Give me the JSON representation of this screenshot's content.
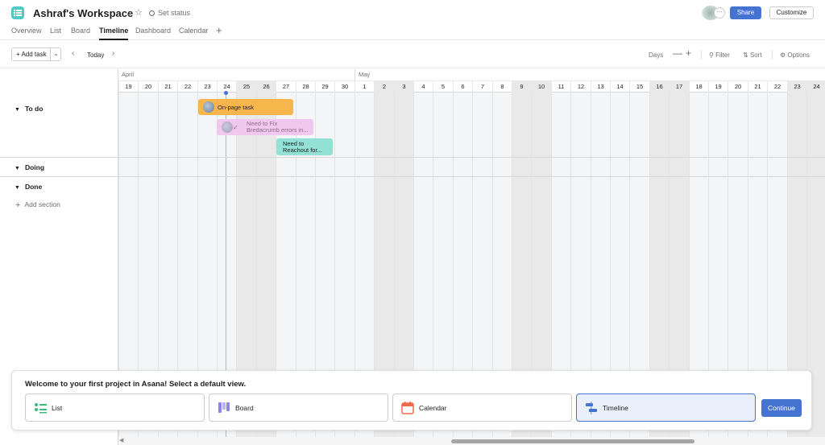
{
  "header": {
    "title": "Ashraf's Workspace",
    "set_status": "Set status",
    "share": "Share",
    "customize": "Customize",
    "tabs": [
      {
        "label": "Overview",
        "active": false
      },
      {
        "label": "List",
        "active": false
      },
      {
        "label": "Board",
        "active": false
      },
      {
        "label": "Timeline",
        "active": true
      },
      {
        "label": "Dashboard",
        "active": false
      },
      {
        "label": "Calendar",
        "active": false
      }
    ]
  },
  "toolbar": {
    "add_task": "Add task",
    "today": "Today",
    "days": "Days",
    "filter": "Filter",
    "sort": "Sort",
    "options": "Options"
  },
  "timeline": {
    "months": [
      "April",
      "May"
    ],
    "days": [
      {
        "d": "19",
        "we": false
      },
      {
        "d": "20",
        "we": false
      },
      {
        "d": "21",
        "we": false
      },
      {
        "d": "22",
        "we": false
      },
      {
        "d": "23",
        "we": false
      },
      {
        "d": "24",
        "we": false
      },
      {
        "d": "25",
        "we": true
      },
      {
        "d": "26",
        "we": true
      },
      {
        "d": "27",
        "we": false
      },
      {
        "d": "28",
        "we": false
      },
      {
        "d": "29",
        "we": false
      },
      {
        "d": "30",
        "we": false
      },
      {
        "d": "1",
        "we": false
      },
      {
        "d": "2",
        "we": true
      },
      {
        "d": "3",
        "we": true
      },
      {
        "d": "4",
        "we": false
      },
      {
        "d": "5",
        "we": false
      },
      {
        "d": "6",
        "we": false
      },
      {
        "d": "7",
        "we": false
      },
      {
        "d": "8",
        "we": false
      },
      {
        "d": "9",
        "we": true
      },
      {
        "d": "10",
        "we": true
      },
      {
        "d": "11",
        "we": false
      },
      {
        "d": "12",
        "we": false
      },
      {
        "d": "13",
        "we": false
      },
      {
        "d": "14",
        "we": false
      },
      {
        "d": "15",
        "we": false
      },
      {
        "d": "16",
        "we": true
      },
      {
        "d": "17",
        "we": true
      },
      {
        "d": "18",
        "we": false
      },
      {
        "d": "19",
        "we": false
      },
      {
        "d": "20",
        "we": false
      },
      {
        "d": "21",
        "we": false
      },
      {
        "d": "22",
        "we": false
      },
      {
        "d": "23",
        "we": true
      },
      {
        "d": "24",
        "we": true
      }
    ],
    "sections": [
      {
        "label": "To do"
      },
      {
        "label": "Doing"
      },
      {
        "label": "Done"
      }
    ],
    "add_section": "Add section",
    "tasks": [
      {
        "name": "On-page task",
        "color": "#f6b64c"
      },
      {
        "name_line1": "Need to Fix",
        "name_line2": "Bredacrumb errors in...",
        "color": "#f0c7ee"
      },
      {
        "name_line1": "Need to",
        "name_line2": "Reachout for...",
        "color": "#93e0d5"
      }
    ]
  },
  "welcome": {
    "title": "Welcome to your first project in Asana! Select a default view.",
    "options": [
      {
        "label": "List",
        "icon": "list-icon",
        "selected": false
      },
      {
        "label": "Board",
        "icon": "board-icon",
        "selected": false
      },
      {
        "label": "Calendar",
        "icon": "calendar-icon",
        "selected": false
      },
      {
        "label": "Timeline",
        "icon": "timeline-icon",
        "selected": true
      }
    ],
    "continue": "Continue"
  },
  "colors": {
    "accent": "#4573d2",
    "project_icon": "#4ecbc4"
  }
}
